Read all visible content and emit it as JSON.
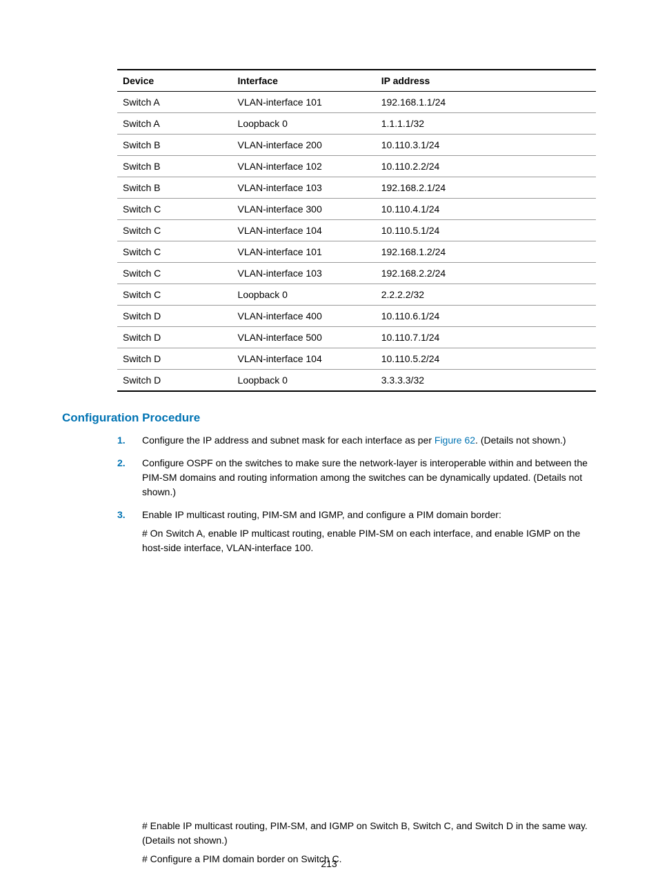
{
  "table": {
    "headers": [
      "Device",
      "Interface",
      "IP address"
    ],
    "rows": [
      [
        "Switch A",
        "VLAN-interface 101",
        "192.168.1.1/24"
      ],
      [
        "Switch A",
        "Loopback 0",
        "1.1.1.1/32"
      ],
      [
        "Switch B",
        "VLAN-interface 200",
        "10.110.3.1/24"
      ],
      [
        "Switch B",
        "VLAN-interface 102",
        "10.110.2.2/24"
      ],
      [
        "Switch B",
        "VLAN-interface 103",
        "192.168.2.1/24"
      ],
      [
        "Switch C",
        "VLAN-interface 300",
        "10.110.4.1/24"
      ],
      [
        "Switch C",
        "VLAN-interface 104",
        "10.110.5.1/24"
      ],
      [
        "Switch C",
        "VLAN-interface 101",
        "192.168.1.2/24"
      ],
      [
        "Switch C",
        "VLAN-interface 103",
        "192.168.2.2/24"
      ],
      [
        "Switch C",
        "Loopback 0",
        "2.2.2.2/32"
      ],
      [
        "Switch D",
        "VLAN-interface 400",
        "10.110.6.1/24"
      ],
      [
        "Switch D",
        "VLAN-interface 500",
        "10.110.7.1/24"
      ],
      [
        "Switch D",
        "VLAN-interface 104",
        "10.110.5.2/24"
      ],
      [
        "Switch D",
        "Loopback 0",
        "3.3.3.3/32"
      ]
    ]
  },
  "heading": "Configuration Procedure",
  "steps": [
    {
      "num": "1.",
      "text_pre": "Configure the IP address and subnet mask for each interface as per ",
      "figref": "Figure 62",
      "text_post": ". (Details not shown.)"
    },
    {
      "num": "2.",
      "text": "Configure OSPF on the switches to make sure the network-layer is interoperable within and between the PIM-SM domains and routing information among the switches can be dynamically updated. (Details not shown.)"
    },
    {
      "num": "3.",
      "text": "Enable IP multicast routing, PIM-SM and IGMP, and configure a PIM domain border:",
      "para": "# On Switch A, enable IP multicast routing, enable PIM-SM on each interface, and enable IGMP on the host-side interface, VLAN-interface 100."
    }
  ],
  "bottom": {
    "p1": "# Enable IP multicast routing, PIM-SM, and IGMP on Switch B, Switch C, and Switch D in the same way. (Details not shown.)",
    "p2": "# Configure a PIM domain border on Switch C."
  },
  "pagenum": "213"
}
